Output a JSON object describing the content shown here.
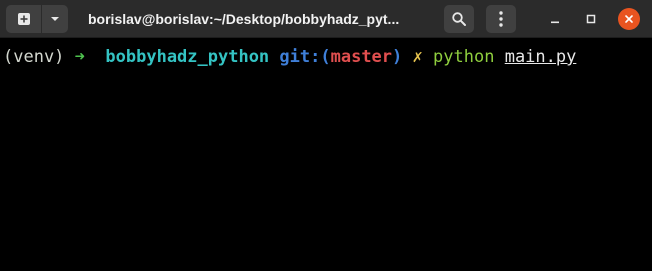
{
  "window": {
    "title": "borislav@borislav:~/Desktop/bobbyhadz_pyt..."
  },
  "titlebar": {
    "new_tab_icon": "new-tab-icon",
    "menu_icon": "chevron-down-icon",
    "search_icon": "search-icon",
    "menu_kebab_icon": "kebab-menu-icon",
    "minimize_icon": "minimize-icon",
    "maximize_icon": "maximize-icon",
    "close_icon": "close-icon"
  },
  "terminal": {
    "prompt": {
      "venv": "(venv)",
      "arrow": "➜",
      "directory": "bobbyhadz_python",
      "git_prefix": "git:(",
      "branch": "master",
      "git_suffix": ")",
      "dirty_marker": "✗",
      "command": "python",
      "argument": "main.py"
    }
  },
  "colors": {
    "titlebar_bg": "#2b2b2b",
    "button_bg": "#404040",
    "close_bg": "#e95420",
    "terminal_bg": "#000000",
    "venv": "#d3d7cf",
    "arrow": "#4ec24e",
    "directory": "#34c3c3",
    "git": "#3f7fd8",
    "branch": "#e04f4f",
    "dirty": "#e5c24e",
    "command": "#8fce3e",
    "argument": "#e8e8e8"
  }
}
